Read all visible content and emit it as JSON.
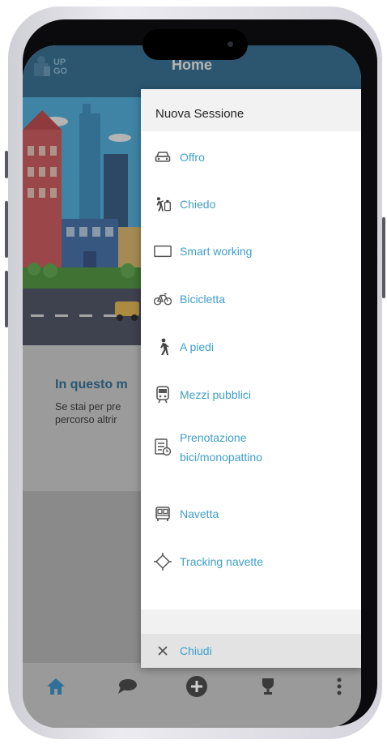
{
  "app": {
    "title": "Home",
    "logo_text_line1": "UP",
    "logo_text_line2": "GO"
  },
  "info": {
    "title": "In questo m",
    "text_line1": "Se stai per pre",
    "text_line2": "percorso altrir"
  },
  "menu": {
    "header": "Nuova Sessione",
    "items": [
      {
        "label": "Offro",
        "icon": "car-icon"
      },
      {
        "label": "Chiedo",
        "icon": "hitchhike-icon"
      },
      {
        "label": "Smart working",
        "icon": "laptop-icon"
      },
      {
        "label": "Bicicletta",
        "icon": "bicycle-icon"
      },
      {
        "label": "A piedi",
        "icon": "walking-icon"
      },
      {
        "label": "Mezzi pubblici",
        "icon": "train-icon"
      },
      {
        "label": "Prenotazione bici/monopattino",
        "label_line1": "Prenotazione",
        "label_line2": "bici/monopattino",
        "icon": "booking-icon"
      },
      {
        "label": "Navetta",
        "icon": "bus-icon"
      },
      {
        "label": "Tracking navette",
        "icon": "tracking-icon"
      }
    ],
    "close_label": "Chiudi"
  },
  "bottom_nav": [
    {
      "icon": "home-icon"
    },
    {
      "icon": "chat-icon"
    },
    {
      "icon": "add-icon"
    },
    {
      "icon": "trophy-icon"
    },
    {
      "icon": "more-vertical-icon"
    }
  ],
  "colors": {
    "appbar": "#2e6f96",
    "accent": "#3f9fc9",
    "info_title": "#2a6f9a"
  }
}
